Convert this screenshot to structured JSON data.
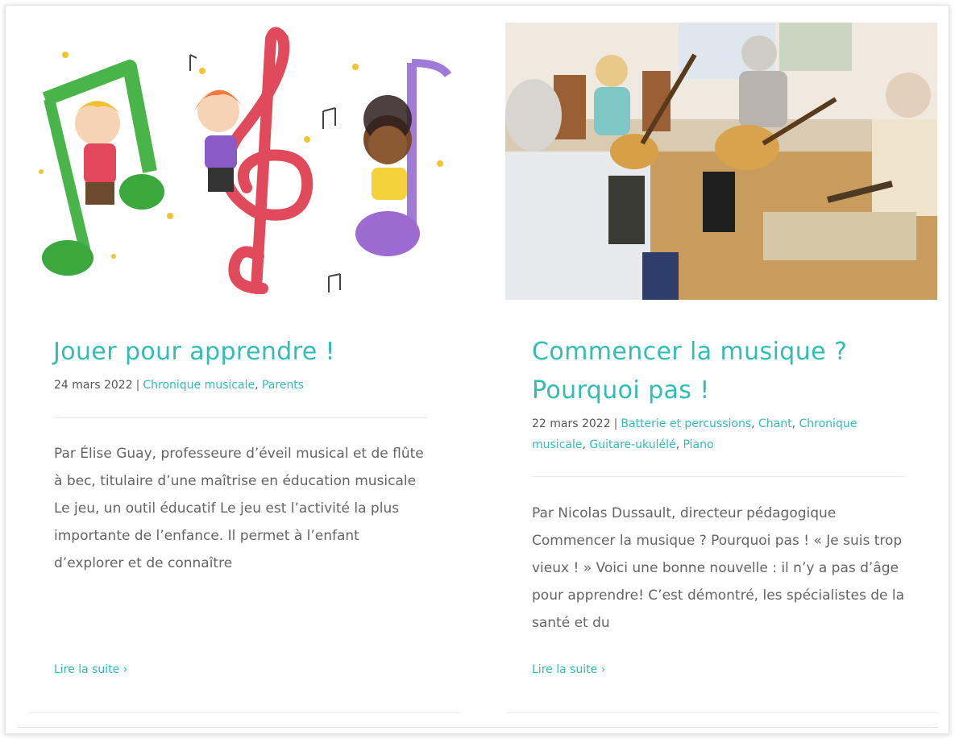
{
  "posts": [
    {
      "image_alt": "",
      "title": "Jouer pour apprendre !",
      "date": "24 mars 2022",
      "separator": "|",
      "categories": [
        "Chronique musicale",
        "Parents"
      ],
      "excerpt": "Par Élise Guay, professeure d’éveil musical et de flûte à bec, titulaire d’une maîtrise en éducation musicale   Le jeu, un outil éducatif Le jeu est l’activité la plus importante de l’enfance. Il permet à l’enfant d’explorer et de connaître",
      "read_more": "Lire la suite"
    },
    {
      "image_alt": "",
      "title": "Commencer la musique ? Pourquoi pas !",
      "date": "22 mars 2022",
      "separator": "|",
      "categories": [
        "Batterie et percussions",
        "Chant",
        "Chronique musicale",
        "Guitare-ukulélé",
        "Piano"
      ],
      "excerpt": "Par Nicolas Dussault, directeur pédagogique Commencer la musique ? Pourquoi pas ! « Je suis trop vieux ! » Voici une bonne nouvelle : il n’y a pas d’âge pour apprendre! C’est démontré, les spécialistes de la santé et du",
      "read_more": "Lire la suite"
    }
  ],
  "read_more_icon": "chevron-right-icon",
  "colors": {
    "accent": "#2fbdb5",
    "text": "#646464",
    "meta": "#555555"
  }
}
